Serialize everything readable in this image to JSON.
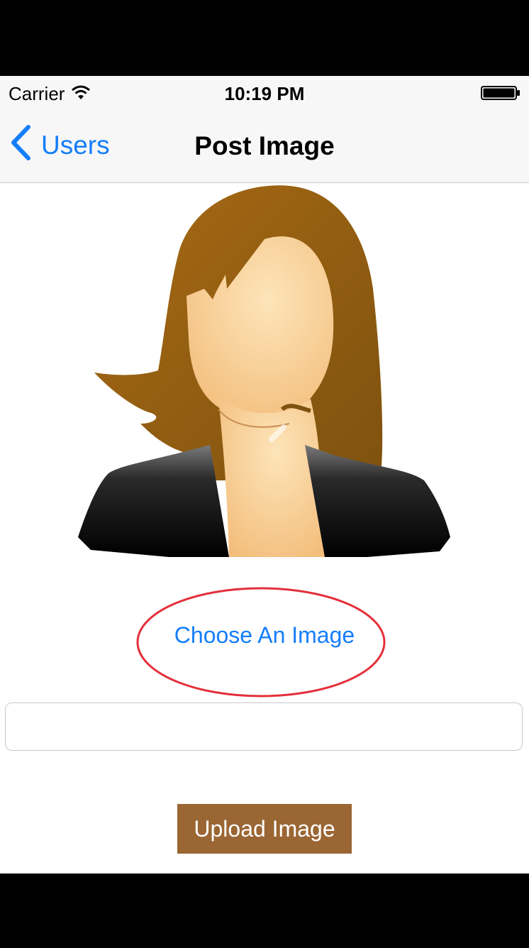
{
  "status_bar": {
    "carrier": "Carrier",
    "time": "10:19 PM"
  },
  "nav": {
    "back_label": "Users",
    "title": "Post Image"
  },
  "main": {
    "choose_label": "Choose An Image",
    "text_field_value": "",
    "upload_label": "Upload Image"
  },
  "colors": {
    "tint": "#157efb",
    "upload_button": "#9a6633",
    "highlight_circle": "#e3303b"
  }
}
